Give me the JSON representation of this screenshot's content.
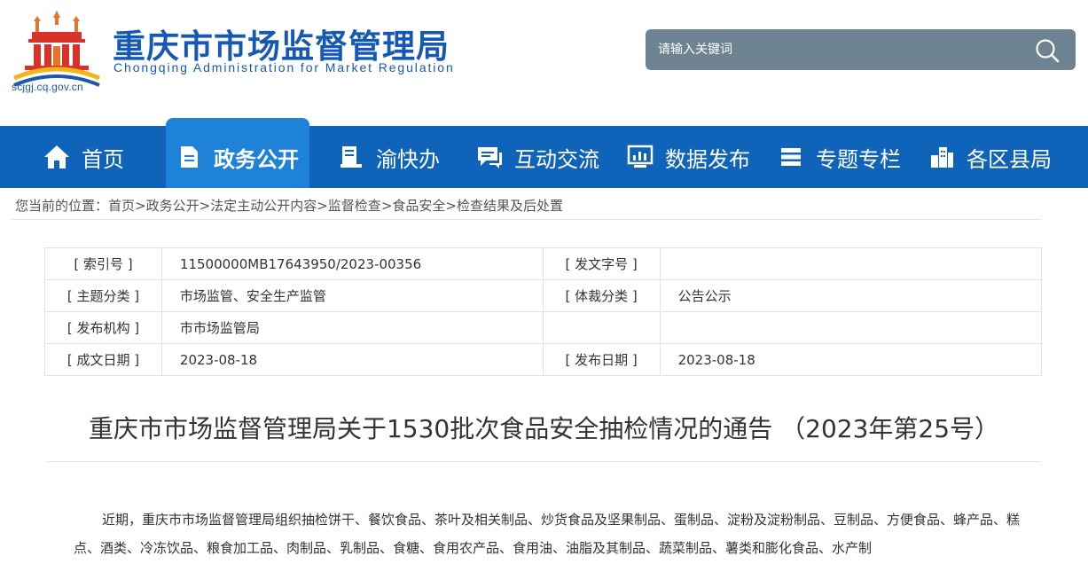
{
  "header": {
    "site_title": "重庆市市场监督管理局",
    "site_subtitle": "Chongqing  Administration for Market Regulation",
    "domain": "scjgj.cq.gov.cn",
    "logo_icon": "government-building-logo-icon",
    "search": {
      "placeholder": "请输入关键词",
      "value": "",
      "icon": "search-icon"
    }
  },
  "colors": {
    "brand_blue": "#1659b4",
    "nav_bg": "#0f63b8",
    "nav_active": "#1d82d8",
    "search_bg": "#6e8392",
    "logo_orange": "#e8732a",
    "logo_red": "#d6332b"
  },
  "nav": {
    "items": [
      {
        "label": "首页",
        "icon": "home-icon"
      },
      {
        "label": "政务公开",
        "icon": "document-icon",
        "active": true
      },
      {
        "label": "渝快办",
        "icon": "book-icon"
      },
      {
        "label": "互动交流",
        "icon": "chat-icon"
      },
      {
        "label": "数据发布",
        "icon": "chart-monitor-icon"
      },
      {
        "label": "专题专栏",
        "icon": "stack-icon"
      },
      {
        "label": "各区县局",
        "icon": "buildings-icon"
      }
    ]
  },
  "breadcrumb": {
    "prefix": "您当前的位置：",
    "items": [
      "首页",
      "政务公开",
      "法定主动公开内容",
      "监督检查",
      "食品安全",
      "检查结果及后处置"
    ],
    "separator": ">"
  },
  "info_table": {
    "rows": [
      {
        "label1": "[ 索引号 ]",
        "value1": "11500000MB17643950/2023-00356",
        "label2": "[ 发文字号 ]",
        "value2": ""
      },
      {
        "label1": "[ 主题分类 ]",
        "value1": "市场监管、安全生产监管",
        "label2": "[ 体裁分类 ]",
        "value2": "公告公示"
      },
      {
        "label1": "[ 发布机构 ]",
        "value1": "市市场监管局",
        "label2": "",
        "value2": ""
      },
      {
        "label1": "[ 成文日期 ]",
        "value1": "2023-08-18",
        "label2": "[ 发布日期 ]",
        "value2": "2023-08-18"
      }
    ]
  },
  "article": {
    "title": "重庆市市场监督管理局关于1530批次食品安全抽检情况的通告 （2023年第25号）",
    "body": "近期，重庆市市场监督管理局组织抽检饼干、餐饮食品、茶叶及相关制品、炒货食品及坚果制品、蛋制品、淀粉及淀粉制品、豆制品、方便食品、蜂产品、糕点、酒类、冷冻饮品、粮食加工品、肉制品、乳制品、食糖、食用农产品、食用油、油脂及其制品、蔬菜制品、薯类和膨化食品、水产制"
  }
}
